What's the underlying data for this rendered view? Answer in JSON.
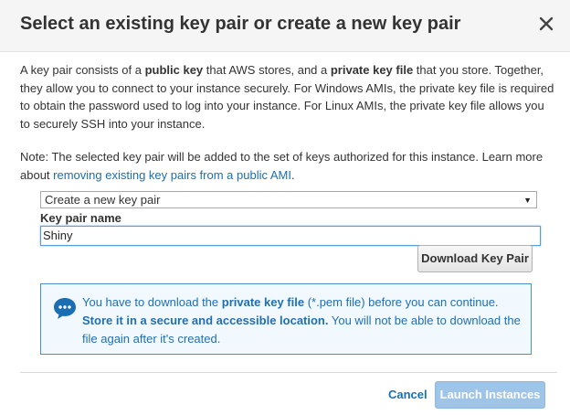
{
  "dialog": {
    "title": "Select an existing key pair or create a new key pair",
    "close_icon": "close-icon"
  },
  "intro": {
    "t1": "A key pair consists of a ",
    "b1": "public key",
    "t2": " that AWS stores, and a ",
    "b2": "private key file",
    "t3": " that you store. Together, they allow you to connect to your instance securely. For Windows AMIs, the private key file is required to obtain the password used to log into your instance. For Linux AMIs, the private key file allows you to securely SSH into your instance."
  },
  "note": {
    "text": "Note: The selected key pair will be added to the set of keys authorized for this instance. Learn more about ",
    "link": "removing existing key pairs from a public AMI",
    "end": "."
  },
  "key_pair_select": {
    "selected": "Create a new key pair",
    "caret_icon": "caret-down-icon"
  },
  "key_pair_name": {
    "label": "Key pair name",
    "value": "Shiny"
  },
  "download_button": "Download Key Pair",
  "info_box": {
    "icon": "chat-bubble-icon",
    "t1": "You have to download the ",
    "b1": "private key file",
    "t2": " (*.pem file) before you can continue. ",
    "b2": "Store it in a secure and accessible location.",
    "t3": " You will not be able to download the file again after it's created."
  },
  "footer": {
    "cancel": "Cancel",
    "launch": "Launch Instances"
  },
  "colors": {
    "accent": "#1a6fb3",
    "info_border": "#4a90c8",
    "info_bg": "#f1f8fe",
    "launch_disabled_bg": "#9ec4e8"
  }
}
